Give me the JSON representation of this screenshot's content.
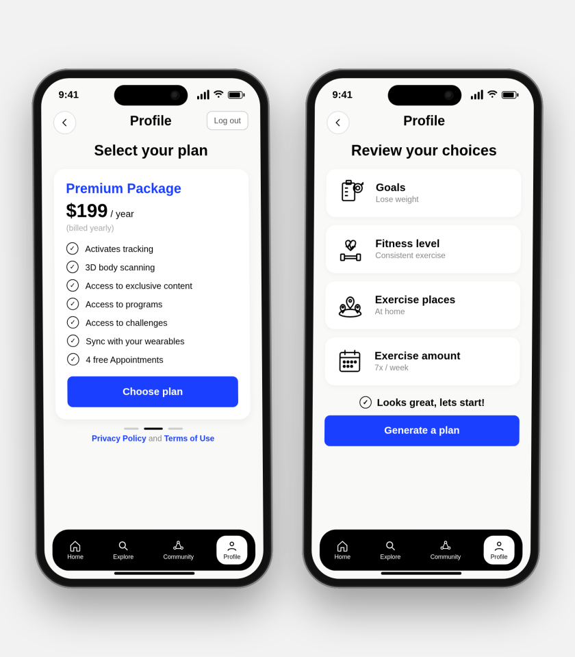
{
  "status": {
    "time": "9:41"
  },
  "header": {
    "title": "Profile",
    "logout_label": "Log out"
  },
  "plan_screen": {
    "title": "Select your plan",
    "plan_name": "Premium Package",
    "price": "$199",
    "period": "/ year",
    "billing_note": "(billed yearly)",
    "features": [
      "Activates tracking",
      "3D body scanning",
      "Access to exclusive content",
      "Access to programs",
      "Access to challenges",
      "Sync with your wearables",
      "4 free Appointments"
    ],
    "cta_label": "Choose plan",
    "legal_privacy": "Privacy Policy",
    "legal_and": " and ",
    "legal_terms": "Terms of Use"
  },
  "review_screen": {
    "title": "Review your choices",
    "items": [
      {
        "title": "Goals",
        "subtitle": "Lose weight"
      },
      {
        "title": "Fitness level",
        "subtitle": "Consistent exercise"
      },
      {
        "title": "Exercise places",
        "subtitle": "At home"
      },
      {
        "title": "Exercise amount",
        "subtitle": "7x / week"
      }
    ],
    "confirm_label": "Looks great, lets start!",
    "cta_label": "Generate a plan"
  },
  "nav": {
    "items": [
      {
        "label": "Home"
      },
      {
        "label": "Explore"
      },
      {
        "label": "Community"
      },
      {
        "label": "Profile"
      }
    ]
  },
  "colors": {
    "accent": "#1a3fff"
  }
}
